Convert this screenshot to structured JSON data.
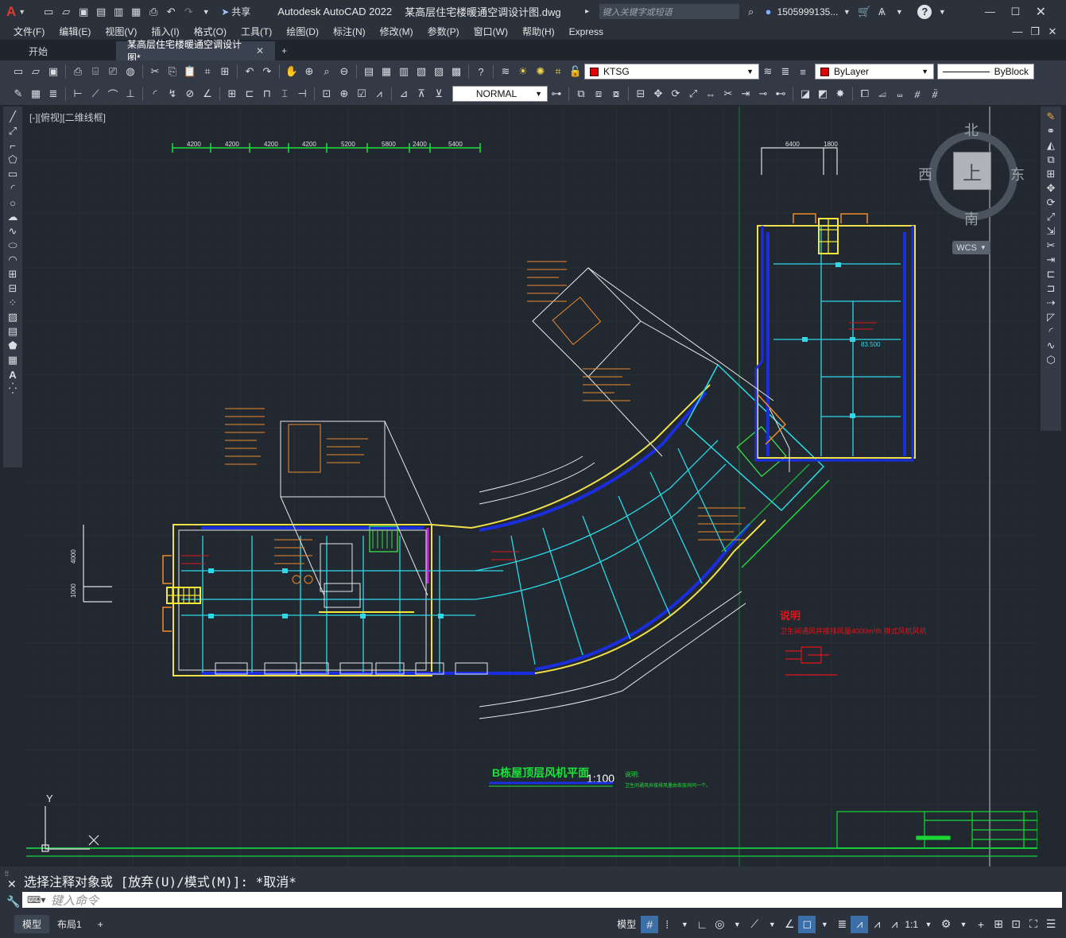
{
  "app": {
    "title": "Autodesk AutoCAD 2022",
    "file": "某高层住宅楼暖通空调设计图.dwg",
    "search_placeholder": "键入关键字或短语",
    "user": "1505999135...",
    "share": "共享",
    "app_letter": "A"
  },
  "menus": [
    "文件(F)",
    "编辑(E)",
    "视图(V)",
    "插入(I)",
    "格式(O)",
    "工具(T)",
    "绘图(D)",
    "标注(N)",
    "修改(M)",
    "参数(P)",
    "窗口(W)",
    "帮助(H)",
    "Express"
  ],
  "tabs": [
    {
      "label": "开始"
    },
    {
      "label": "某高层住宅楼暖通空调设计图*"
    }
  ],
  "layer": {
    "name": "KTSG",
    "color": "#e00000"
  },
  "color_prop": {
    "name": "ByLayer",
    "color": "#e00000"
  },
  "linetype": "ByBlock",
  "text_style": "NORMAL",
  "viewport_label": "[-][俯视][二维线框]",
  "viewcube": {
    "north": "北",
    "south": "南",
    "east": "东",
    "west": "西",
    "top": "上",
    "wcs": "WCS"
  },
  "drawing": {
    "dims_top": [
      "4200",
      "4200",
      "4200",
      "4200",
      "5200",
      "5800",
      "2400",
      "5400"
    ],
    "dims_right": [
      "6400",
      "1800"
    ],
    "dims_left": [
      "4000",
      "1000"
    ],
    "main_title": "B栋屋顶层风机平面",
    "scale": "1:100",
    "note_head": "说明",
    "note_text": "卫生间通风井接排风量4000m³/h 排式风机风机",
    "level": "83.500",
    "small_note": "说明:",
    "small_note_text": "卫生间通风井接排风量由各层共同一个。"
  },
  "ucs": {
    "x": "X",
    "y": "Y"
  },
  "command": {
    "history": "选择注释对象或 [放弃(U)/模式(M)]: *取消*",
    "placeholder": "键入命令"
  },
  "layout_tabs": [
    {
      "label": "模型"
    },
    {
      "label": "布局1"
    }
  ],
  "status": {
    "model": "模型",
    "scale": "1:1"
  }
}
